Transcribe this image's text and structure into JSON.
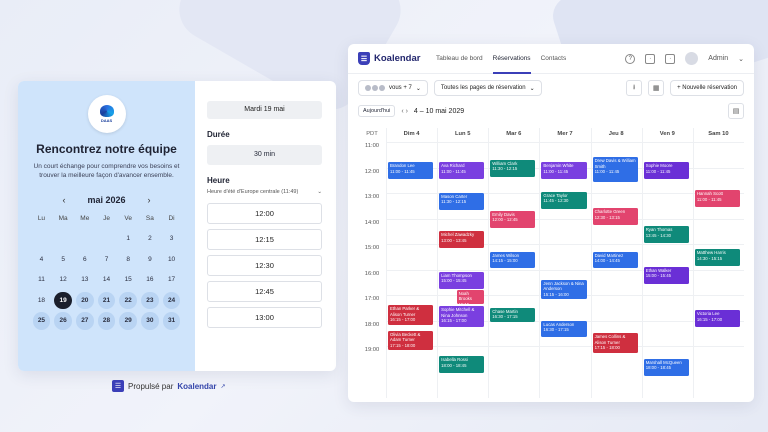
{
  "booking": {
    "logo_text": "DAAS",
    "title": "Rencontrez notre équipe",
    "description": "Un court échange pour comprendre vos besoins et trouver la meilleure façon d'avancer ensemble.",
    "month": "mai 2026",
    "weekdays": [
      "Lu",
      "Ma",
      "Me",
      "Je",
      "Ve",
      "Sa",
      "Di"
    ],
    "weeks": [
      [
        "",
        "",
        "",
        "",
        "1",
        "2",
        "3"
      ],
      [
        "4",
        "5",
        "6",
        "7",
        "8",
        "9",
        "10"
      ],
      [
        "11",
        "12",
        "13",
        "14",
        "15",
        "16",
        "17"
      ],
      [
        "18",
        "19",
        "20",
        "21",
        "22",
        "23",
        "24"
      ],
      [
        "25",
        "26",
        "27",
        "28",
        "29",
        "30",
        "31"
      ]
    ],
    "available_days": [
      "19",
      "20",
      "21",
      "22",
      "23",
      "24",
      "25",
      "26",
      "27",
      "28",
      "29",
      "30",
      "31"
    ],
    "selected_day": "19",
    "selected_date": "Mardi 19 mai",
    "duration_label": "Durée",
    "duration_value": "30 min",
    "time_label": "Heure",
    "timezone": "Heure d'été d'Europe centrale (11:49)",
    "slots": [
      "12:00",
      "12:15",
      "12:30",
      "12:45",
      "13:00"
    ]
  },
  "powered": {
    "prefix": "Propulsé par",
    "brand": "Koalendar"
  },
  "dashboard": {
    "brand": "Koalendar",
    "nav": [
      "Tableau de bord",
      "Réservations",
      "Contacts"
    ],
    "active_nav": "Réservations",
    "user": "Admin",
    "filter_users": "vous + 7",
    "filter_pages": "Toutes les pages de réservation",
    "new_button": "+ Nouvelle réservation",
    "today_button": "Aujourd'hui",
    "range_arrows": "‹  ›",
    "range": "4 – 10 mai 2029",
    "tz_label": "PDT",
    "days": [
      "Dim 4",
      "Lun 5",
      "Mar 6",
      "Mer 7",
      "Jeu 8",
      "Ven 9",
      "Sam 10"
    ],
    "hours": [
      "11:00",
      "12:00",
      "13:00",
      "14:00",
      "15:00",
      "16:00",
      "17:00",
      "18:00",
      "19:00"
    ],
    "colors": {
      "blue": "#2f6ee6",
      "purple": "#7a3fe0",
      "pink": "#e2446e",
      "green": "#159a6a",
      "red": "#cf2f3f",
      "violet": "#6a2fd6",
      "teal": "#0f8a7a"
    },
    "events": [
      {
        "day": 0,
        "start": 11.8,
        "end": 12.5,
        "color": "blue",
        "name": "Brandon Lee",
        "time": "11:00 - 11:45"
      },
      {
        "day": 0,
        "start": 17.4,
        "end": 18.2,
        "color": "red",
        "name": "Ethan Parker & Alison Turner",
        "time": "16:15 - 17:00"
      },
      {
        "day": 0,
        "start": 18.4,
        "end": 19.2,
        "color": "red",
        "name": "Olivia Beckett & Adam Turner",
        "time": "17:15 - 18:00"
      },
      {
        "day": 1,
        "start": 11.8,
        "end": 12.5,
        "color": "purple",
        "name": "Ava Richard",
        "time": "11:00 - 11:45"
      },
      {
        "day": 1,
        "start": 13.0,
        "end": 13.7,
        "color": "blue",
        "name": "Mason Carter",
        "time": "11:30 - 12:15"
      },
      {
        "day": 1,
        "start": 14.5,
        "end": 15.2,
        "color": "red",
        "name": "Michel Zawadzky",
        "time": "13:00 - 13:45"
      },
      {
        "day": 1,
        "start": 16.1,
        "end": 16.8,
        "color": "purple",
        "name": "Liam Thompson",
        "time": "15:00 - 15:45"
      },
      {
        "day": 1,
        "start": 16.8,
        "end": 17.4,
        "color": "pink",
        "name": "Noah Brooks",
        "time": "15:15 - 16:00",
        "indent": true
      },
      {
        "day": 1,
        "start": 17.45,
        "end": 18.3,
        "color": "purple",
        "name": "Sophie Mitchell & Nina Johnson",
        "time": "16:15 - 17:00"
      },
      {
        "day": 1,
        "start": 19.4,
        "end": 20.1,
        "color": "teal",
        "name": "Isabella Rossi",
        "time": "18:00 - 18:45"
      },
      {
        "day": 2,
        "start": 11.7,
        "end": 12.4,
        "color": "teal",
        "name": "William Clark",
        "time": "11:30 - 12:15"
      },
      {
        "day": 2,
        "start": 13.7,
        "end": 14.4,
        "color": "pink",
        "name": "Emily Davis",
        "time": "12:00 - 12:45"
      },
      {
        "day": 2,
        "start": 15.3,
        "end": 16.0,
        "color": "blue",
        "name": "James Wilson",
        "time": "14:15 - 15:00"
      },
      {
        "day": 2,
        "start": 17.5,
        "end": 18.1,
        "color": "teal",
        "name": "Chase Martin",
        "time": "16:30 - 17:15"
      },
      {
        "day": 3,
        "start": 11.8,
        "end": 12.5,
        "color": "purple",
        "name": "Benjamin White",
        "time": "11:00 - 11:45"
      },
      {
        "day": 3,
        "start": 12.95,
        "end": 13.65,
        "color": "teal",
        "name": "Grace Taylor",
        "time": "11:45 - 12:30"
      },
      {
        "day": 3,
        "start": 16.4,
        "end": 17.2,
        "color": "blue",
        "name": "Jenn Jackson & Nina Anderson",
        "time": "15:15 - 16:00"
      },
      {
        "day": 3,
        "start": 18.0,
        "end": 18.7,
        "color": "blue",
        "name": "Lucas Anderson",
        "time": "16:30 - 17:15"
      },
      {
        "day": 4,
        "start": 11.6,
        "end": 12.6,
        "color": "blue",
        "name": "Drew Davis & William Smith",
        "time": "11:00 - 11:45"
      },
      {
        "day": 4,
        "start": 13.6,
        "end": 14.3,
        "color": "pink",
        "name": "Charlotte Green",
        "time": "12:30 - 13:15"
      },
      {
        "day": 4,
        "start": 15.3,
        "end": 16.0,
        "color": "blue",
        "name": "David Martinez",
        "time": "14:00 - 14:45"
      },
      {
        "day": 4,
        "start": 18.5,
        "end": 19.3,
        "color": "red",
        "name": "James Collins & Alison Turner",
        "time": "17:15 - 18:00"
      },
      {
        "day": 5,
        "start": 11.8,
        "end": 12.5,
        "color": "violet",
        "name": "Sophie Moore",
        "time": "11:00 - 11:45"
      },
      {
        "day": 5,
        "start": 14.3,
        "end": 15.0,
        "color": "teal",
        "name": "Ryan Thomas",
        "time": "13:45 - 14:30"
      },
      {
        "day": 5,
        "start": 15.9,
        "end": 16.6,
        "color": "violet",
        "name": "Ethan Walker",
        "time": "15:00 - 15:45"
      },
      {
        "day": 5,
        "start": 19.5,
        "end": 20.2,
        "color": "blue",
        "name": "Marshall McQueen",
        "time": "18:00 - 18:45"
      },
      {
        "day": 6,
        "start": 12.9,
        "end": 13.6,
        "color": "pink",
        "name": "Hannah Scott",
        "time": "11:00 - 11:45"
      },
      {
        "day": 6,
        "start": 15.2,
        "end": 15.9,
        "color": "teal",
        "name": "Matthew Harris",
        "time": "14:30 - 15:15"
      },
      {
        "day": 6,
        "start": 17.6,
        "end": 18.3,
        "color": "violet",
        "name": "Victoria Lee",
        "time": "16:15 - 17:00"
      }
    ]
  }
}
